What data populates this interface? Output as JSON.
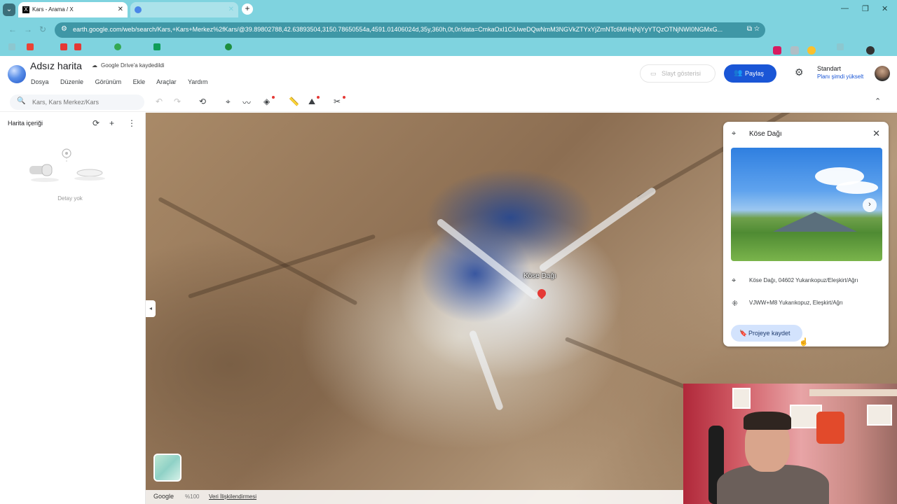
{
  "browser": {
    "tabs": [
      {
        "title": "Kars - Arama / X",
        "active": true
      },
      {
        "title": "",
        "active": false
      }
    ],
    "url": "earth.google.com/web/search/Kars,+Kars+Merkez%2fKars/@39.89802788,42.63893504,3150.78650554a,4591.01406024d,35y,360h,0t,0r/data=CmkaOxI1CiUweDQwNmM3NGVkZTYxYjZmNTc6MHhjNjYyYTQzOTNjNWI0NGMxG..."
  },
  "app": {
    "title": "Adsız harita",
    "drive_status": "Google Drive'a kaydedildi",
    "menu": [
      "Dosya",
      "Düzenle",
      "Görünüm",
      "Ekle",
      "Araçlar",
      "Yardım"
    ],
    "slideshow_label": "Slayt gösterisi",
    "share_label": "Paylaş",
    "plan_name": "Standart",
    "plan_upgrade": "Planı şimdi yükselt"
  },
  "toolbar": {
    "search_placeholder": "Kars, Kars Merkez/Kars"
  },
  "sidebar": {
    "title": "Harita içeriği",
    "empty_text": "Detay yok"
  },
  "map": {
    "place_label": "Köse Dağı",
    "google_label": "Google",
    "zoom": "%100",
    "data_attribution": "Veri İlişkilendirmesi"
  },
  "info_card": {
    "title": "Köse Dağı",
    "address": "Köse Dağı, 04602 Yukarıkopuz/Eleşkirt/Ağrı",
    "plus_code": "VJWW+M8 Yukarıkopuz, Eleşkirt/Ağrı",
    "save_label": "Projeye kaydet"
  },
  "colors": {
    "accent": "#1a56d6",
    "browser_bar": "#7fd3df",
    "pin": "#e53935"
  }
}
